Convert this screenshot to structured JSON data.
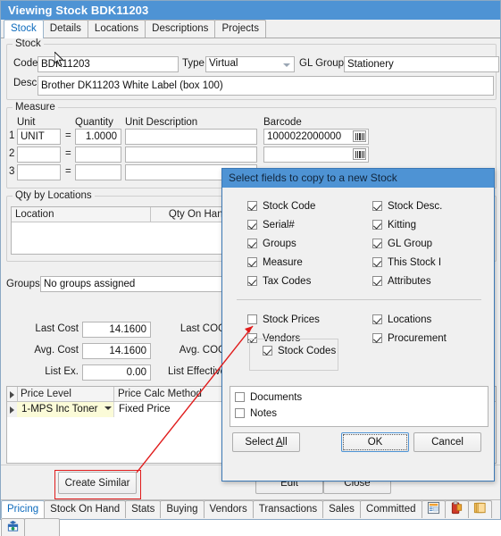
{
  "window": {
    "title": "Viewing Stock BDK11203"
  },
  "tabs": [
    {
      "label": "Stock",
      "selected": true
    },
    {
      "label": "Details",
      "selected": false
    },
    {
      "label": "Locations",
      "selected": false
    },
    {
      "label": "Descriptions",
      "selected": false
    },
    {
      "label": "Projects",
      "selected": false
    }
  ],
  "stock_group": {
    "legend": "Stock",
    "code_label": "Code",
    "code_value": "BDK11203",
    "type_label": "Type",
    "type_value": "Virtual",
    "gl_group_label": "GL Group",
    "gl_group_value": "Stationery",
    "desc_label": "Desc",
    "desc_value": "Brother DK11203 White Label (box 100)"
  },
  "measure_group": {
    "legend": "Measure",
    "headers": {
      "unit": "Unit",
      "quantity": "Quantity",
      "unit_description": "Unit Description",
      "barcode": "Barcode"
    },
    "rows": [
      {
        "n": "1",
        "unit": "UNIT",
        "eq": "=",
        "quantity": "1.0000",
        "unit_description": "",
        "barcode": "1000022000000"
      },
      {
        "n": "2",
        "unit": "",
        "eq": "=",
        "quantity": "",
        "unit_description": "",
        "barcode": ""
      },
      {
        "n": "3",
        "unit": "",
        "eq": "=",
        "quantity": "",
        "unit_description": "",
        "barcode": ""
      }
    ]
  },
  "qty_group": {
    "legend": "Qty by Locations",
    "columns": [
      "Location",
      "Qty On Hand"
    ],
    "rows": []
  },
  "groups_field": {
    "label": "Groups",
    "value": "No groups assigned"
  },
  "costs": {
    "last_cost_label": "Last Cost",
    "last_cost_value": "14.1600",
    "avg_cost_label": "Avg. Cost",
    "avg_cost_value": "14.1600",
    "list_ex_label": "List Ex.",
    "list_ex_value": "0.00",
    "last_cog_label": "Last COG",
    "last_cog_value": "",
    "avg_cog_label": "Avg. COG",
    "avg_cog_value": "",
    "list_effective_label": "List Effective",
    "list_effective_value": ""
  },
  "price_grid": {
    "columns": [
      "Price Level",
      "Price Calc Method"
    ],
    "rows": [
      {
        "level": "1-MPS Inc Toner",
        "method": "Fixed Price"
      }
    ]
  },
  "footer": {
    "create_similar": "Create Similar",
    "edit": "Edit",
    "close": "Close"
  },
  "bottom_tabs": [
    {
      "label": "Pricing",
      "selected": true
    },
    {
      "label": "Stock On Hand",
      "selected": false
    },
    {
      "label": "Stats",
      "selected": false
    },
    {
      "label": "Buying",
      "selected": false
    },
    {
      "label": "Vendors",
      "selected": false
    },
    {
      "label": "Transactions",
      "selected": false
    },
    {
      "label": "Sales",
      "selected": false
    },
    {
      "label": "Committed",
      "selected": false
    }
  ],
  "bottom_tab_icons": [
    {
      "name": "report-icon"
    },
    {
      "name": "clipboard-icon"
    },
    {
      "name": "copy-documents-icon"
    },
    {
      "name": "gift-box-icon"
    }
  ],
  "dialog": {
    "title": "Select fields to copy to a new Stock",
    "left_checks": [
      {
        "label": "Stock Code",
        "checked": true
      },
      {
        "label": "Serial#",
        "checked": true
      },
      {
        "label": "Groups",
        "checked": true
      },
      {
        "label": "Measure",
        "checked": true
      },
      {
        "label": "Tax Codes",
        "checked": true
      }
    ],
    "right_checks": [
      {
        "label": "Stock Desc.",
        "checked": true
      },
      {
        "label": "Kitting",
        "checked": true
      },
      {
        "label": "GL Group",
        "checked": true
      },
      {
        "label": "This Stock I",
        "checked": true
      },
      {
        "label": "Attributes",
        "checked": true
      }
    ],
    "left_checks2": [
      {
        "label": "Stock Prices",
        "checked": false
      },
      {
        "label": "Vendors",
        "checked": true
      }
    ],
    "nested_check": {
      "label": "Stock Codes",
      "checked": true
    },
    "right_checks2": [
      {
        "label": "Locations",
        "checked": true
      },
      {
        "label": "Procurement",
        "checked": true
      }
    ],
    "panel_checks": [
      {
        "label": "Documents",
        "checked": false
      },
      {
        "label": "Notes",
        "checked": false
      }
    ],
    "buttons": {
      "select_all": "Select All",
      "select_all_accel": "A",
      "ok": "OK",
      "cancel": "Cancel"
    }
  },
  "colors": {
    "titlebar": "#4e93d4",
    "accent_tab_text": "#0d6bbd",
    "annotation_red": "#e01b1b",
    "selected_row": "#fbfbd8"
  }
}
